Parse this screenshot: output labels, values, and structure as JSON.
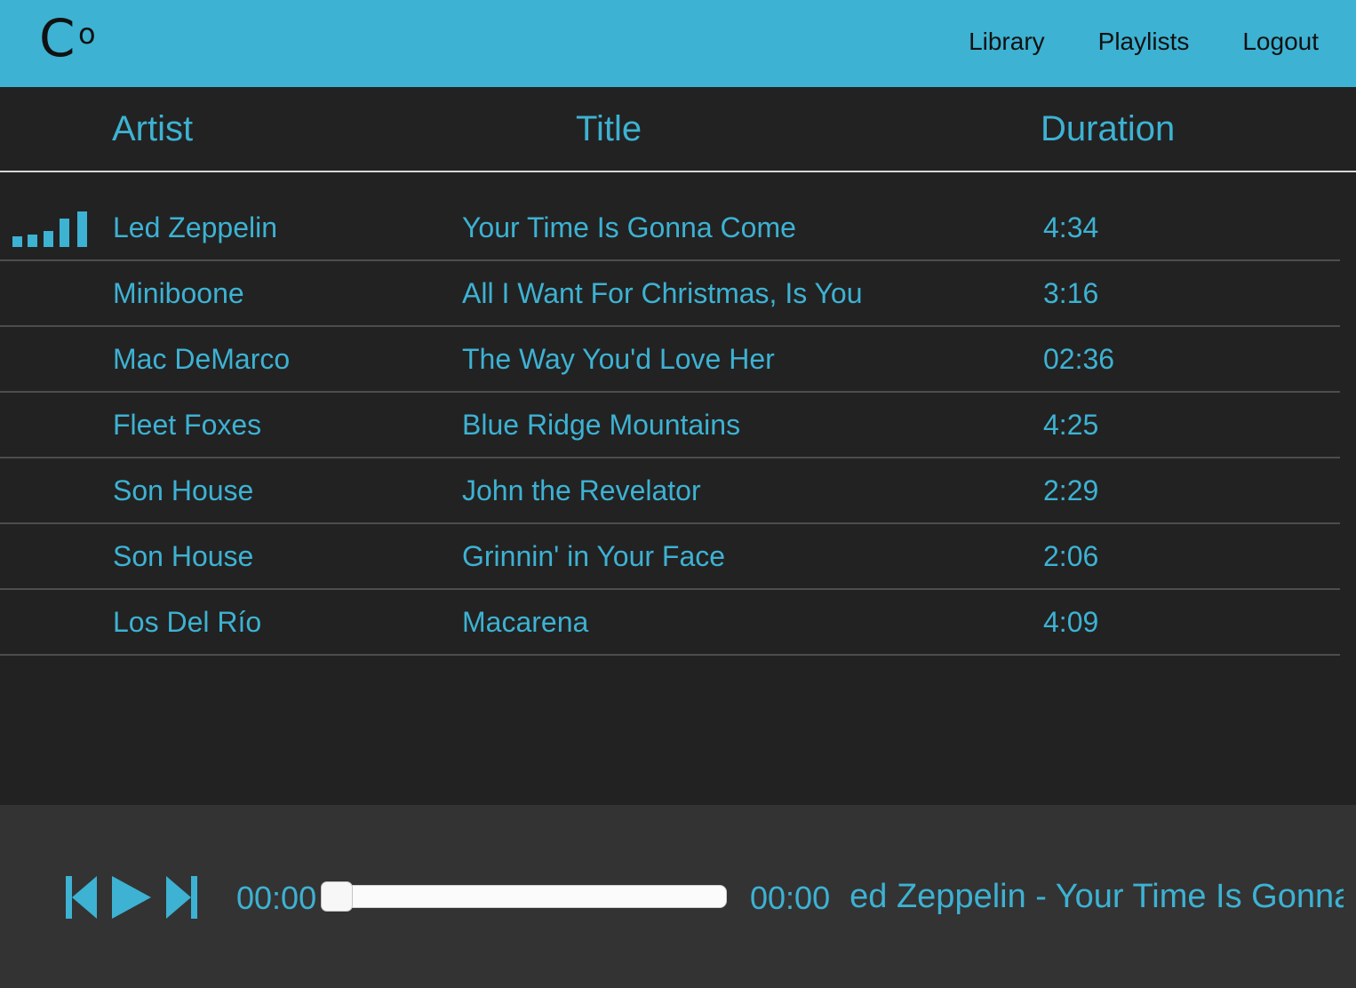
{
  "app": {
    "logo_letter": "C",
    "logo_sup": "o"
  },
  "nav": {
    "library": "Library",
    "playlists": "Playlists",
    "logout": "Logout"
  },
  "table": {
    "headers": {
      "artist": "Artist",
      "title": "Title",
      "duration": "Duration"
    },
    "rows": [
      {
        "artist": "Led Zeppelin",
        "title": "Your Time Is Gonna Come",
        "duration": "4:34",
        "playing": true
      },
      {
        "artist": "Miniboone",
        "title": "All I Want For Christmas, Is You",
        "duration": "3:16"
      },
      {
        "artist": "Mac DeMarco",
        "title": "The Way You'd Love Her",
        "duration": "02:36"
      },
      {
        "artist": "Fleet Foxes",
        "title": "Blue Ridge Mountains",
        "duration": "4:25"
      },
      {
        "artist": "Son House",
        "title": "John the Revelator",
        "duration": "2:29"
      },
      {
        "artist": "Son House",
        "title": "Grinnin' in Your Face",
        "duration": "2:06"
      },
      {
        "artist": "Los Del Río",
        "title": "Macarena",
        "duration": "4:09"
      }
    ]
  },
  "player": {
    "current_time": "00:00",
    "total_time": "00:00",
    "progress": 0,
    "now_playing": "Led Zeppelin - Your Time Is Gonna Come",
    "icons": {
      "prev": "skip-previous-icon",
      "play": "play-icon",
      "next": "skip-next-icon",
      "playing_indicator": "equalizer-icon"
    }
  },
  "colors": {
    "accent": "#3db2d3",
    "background": "#222222",
    "player_bg": "#333333",
    "row_divider": "#4d4d4d"
  }
}
